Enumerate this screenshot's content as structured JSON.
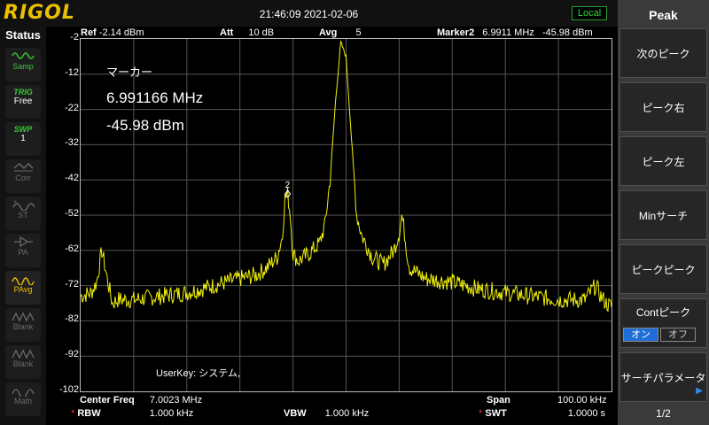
{
  "header": {
    "logo": "RIGOL",
    "datetime": "21:46:09 2021-02-06",
    "local_label": "Local"
  },
  "status": {
    "title": "Status",
    "items": [
      {
        "name": "sweep-mode-samp",
        "label": "Samp",
        "icon": "sine-wave-icon"
      },
      {
        "name": "trigger-free",
        "top": "TRIG",
        "label": "Free"
      },
      {
        "name": "sweep-count",
        "top": "SWP",
        "label": "1"
      },
      {
        "name": "corr",
        "label": "Corr",
        "icon": "corr-icon"
      },
      {
        "name": "st",
        "label": "ST",
        "icon": "st-icon"
      },
      {
        "name": "pa",
        "label": "PA",
        "icon": "pa-icon"
      },
      {
        "name": "pavg",
        "label": "PAvg",
        "icon": "pavg-icon"
      },
      {
        "name": "blank-1",
        "label": "Blank",
        "icon": "blank-icon"
      },
      {
        "name": "blank-2",
        "label": "Blank",
        "icon": "blank-icon"
      },
      {
        "name": "math",
        "label": "Math",
        "icon": "math-icon"
      }
    ]
  },
  "params": {
    "ref_label": "Ref",
    "ref_value": "-2.14 dBm",
    "att_label": "Att",
    "att_value": "10 dB",
    "avg_label": "Avg",
    "avg_value": "5",
    "marker_label": "Marker2",
    "marker_freq": "6.9911 MHz",
    "marker_amp": "-45.98 dBm"
  },
  "marker_box": {
    "title": "マーカー",
    "freq": "6.991166 MHz",
    "amp": "-45.98 dBm",
    "marker_id": "2"
  },
  "userkey": "UserKey:   システム,",
  "footer": {
    "center_label": "Center Freq",
    "center_value": "7.0023 MHz",
    "span_label": "Span",
    "span_value": "100.00 kHz",
    "rbw_label": "RBW",
    "rbw_value": "1.000 kHz",
    "vbw_label": "VBW",
    "vbw_value": "1.000 kHz",
    "swt_label": "SWT",
    "swt_value": "1.0000 s",
    "star": "*"
  },
  "menu": {
    "title": "Peak",
    "buttons": [
      "次のピーク",
      "ピーク右",
      "ピーク左",
      "Minサーチ",
      "ピークピーク"
    ],
    "cont_label": "Contピーク",
    "cont_on": "オン",
    "cont_off": "オフ",
    "search_params": "サーチパラメータ",
    "page": "1/2"
  },
  "chart_data": {
    "type": "line",
    "title": "",
    "xlabel": "",
    "ylabel": "",
    "y_ticks": [
      -2,
      -12,
      -22,
      -32,
      -42,
      -52,
      -62,
      -72,
      -82,
      -92,
      -102
    ],
    "ylim": [
      -102,
      -2
    ],
    "xlim": [
      6.9523,
      7.0523
    ],
    "x_unit": "MHz",
    "y_unit": "dBm",
    "trace_color": "#f2f20a",
    "grid": true,
    "series": [
      {
        "x": [
          6.9523,
          6.9543,
          6.9553,
          6.9563,
          6.9573,
          6.9583,
          6.9593,
          6.9623,
          6.9673,
          6.9723,
          6.9773,
          6.9823,
          6.9853,
          6.9873,
          6.9893,
          6.9903,
          6.9908,
          6.9913,
          6.9918,
          6.9923,
          6.9933,
          6.9953,
          6.9973,
          6.9983,
          6.9993,
          7.0003,
          7.0013,
          7.0023,
          7.0033,
          7.0043,
          7.0053,
          7.0063,
          7.0073,
          7.0093,
          7.0113,
          7.0123,
          7.0128,
          7.0133,
          7.0138,
          7.0143,
          7.0153,
          7.0173,
          7.0223,
          7.0273,
          7.0323,
          7.0373,
          7.0423,
          7.0473,
          7.0493,
          7.0503,
          7.0513,
          7.0523
        ],
        "y": [
          -75,
          -74,
          -71,
          -62,
          -70,
          -77,
          -76,
          -76,
          -75,
          -74,
          -72,
          -70,
          -69,
          -67,
          -64,
          -58,
          -47,
          -45.98,
          -52,
          -63,
          -65,
          -63,
          -60,
          -55,
          -42,
          -20,
          -3,
          -7,
          -30,
          -52,
          -58,
          -61,
          -64,
          -66,
          -62,
          -57,
          -52,
          -57,
          -63,
          -67,
          -68,
          -70,
          -71,
          -73,
          -74,
          -75,
          -76,
          -76,
          -72,
          -75,
          -77,
          -78
        ]
      }
    ]
  }
}
